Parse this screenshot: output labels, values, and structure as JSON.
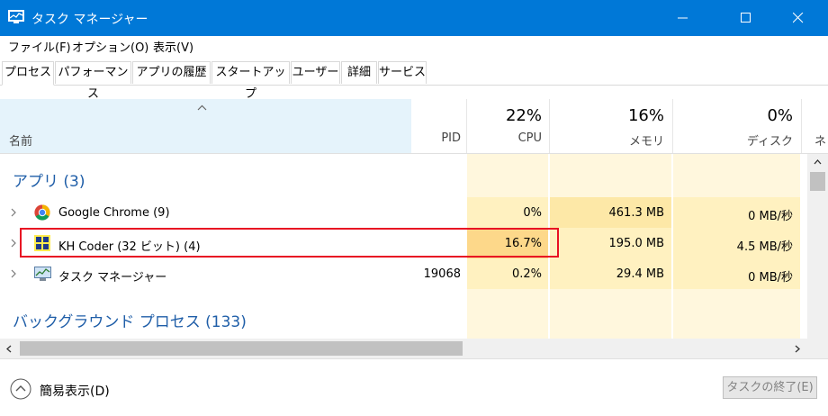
{
  "window": {
    "title": "タスク マネージャー"
  },
  "menu": {
    "file": "ファイル(F)",
    "options": "オプション(O)",
    "view": "表示(V)"
  },
  "tabs": [
    "プロセス",
    "パフォーマンス",
    "アプリの履歴",
    "スタートアップ",
    "ユーザー",
    "詳細",
    "サービス"
  ],
  "columns": {
    "name": "名前",
    "pid": "PID",
    "cpu": {
      "pct": "22%",
      "label": "CPU"
    },
    "memory": {
      "pct": "16%",
      "label": "メモリ"
    },
    "disk": {
      "pct": "0%",
      "label": "ディスク"
    },
    "network_partial": "ネ"
  },
  "groups": {
    "apps": "アプリ (3)",
    "background": "バックグラウンド プロセス (133)"
  },
  "rows": [
    {
      "name": "Google Chrome (9)",
      "pid": "",
      "cpu": "0%",
      "memory": "461.3 MB",
      "disk": "0 MB/秒"
    },
    {
      "name": "KH Coder (32 ビット) (4)",
      "pid": "",
      "cpu": "16.7%",
      "memory": "195.0 MB",
      "disk": "4.5 MB/秒"
    },
    {
      "name": "タスク マネージャー",
      "pid": "19068",
      "cpu": "0.2%",
      "memory": "29.4 MB",
      "disk": "0 MB/秒"
    }
  ],
  "footer": {
    "fewer_details": "簡易表示(D)",
    "end_task": "タスクの終了(E)"
  },
  "colors": {
    "titlebar": "#0078d7",
    "highlight": "#e81123",
    "group": "#1f5ea8"
  }
}
